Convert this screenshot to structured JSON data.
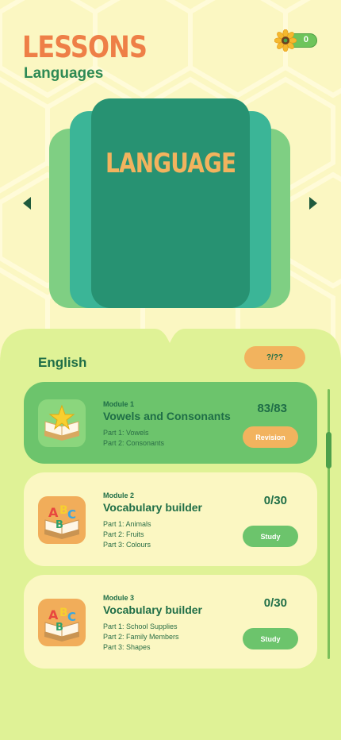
{
  "header": {
    "title": "LESSONS",
    "subtitle": "Languages",
    "coins": "0",
    "coin_icon": "sunflower-coin-icon"
  },
  "carousel": {
    "book_title": "LANGUAGE",
    "prev_icon": "triangle-left-icon",
    "next_icon": "triangle-right-icon"
  },
  "course": {
    "name": "English",
    "progress": "?/??"
  },
  "modules": [
    {
      "number": "Module 1",
      "title": "Vowels and Consonants",
      "parts": [
        "Part 1: Vowels",
        "Part 2: Consonants"
      ],
      "score": "83/83",
      "button": "Revision",
      "icon": "star-book-icon"
    },
    {
      "number": "Module 2",
      "title": "Vocabulary builder",
      "parts": [
        "Part 1: Animals",
        "Part 2: Fruits",
        "Part 3: Colours"
      ],
      "score": "0/30",
      "button": "Study",
      "icon": "abc-book-icon"
    },
    {
      "number": "Module 3",
      "title": "Vocabulary builder",
      "parts": [
        "Part 1: School Supplies",
        "Part 2: Family Members",
        "Part 3: Shapes"
      ],
      "score": "0/30",
      "button": "Study",
      "icon": "abc-book-icon"
    }
  ],
  "colors": {
    "background": "#fbf7c2",
    "accent_orange": "#ee7f47",
    "dark_green": "#1f6e47",
    "book_front": "#279272",
    "button_green": "#6cc46c",
    "button_orange": "#f2b35e"
  }
}
